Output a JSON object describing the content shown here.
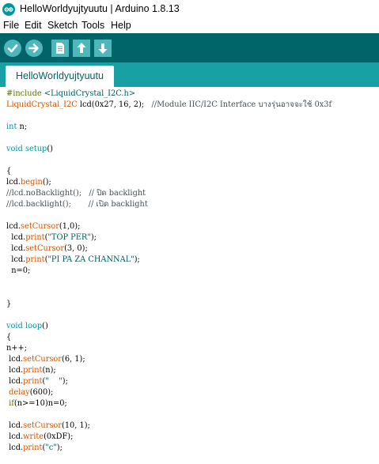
{
  "window": {
    "title": "HelloWorldyujtyuutu | Arduino 1.8.13",
    "app_icon": "arduino-logo-icon"
  },
  "menu": {
    "items": [
      "File",
      "Edit",
      "Sketch",
      "Tools",
      "Help"
    ]
  },
  "toolbar": {
    "buttons": [
      {
        "name": "verify",
        "icon": "checkmark-icon"
      },
      {
        "name": "upload",
        "icon": "arrow-right-icon"
      },
      {
        "name": "new",
        "icon": "new-file-icon"
      },
      {
        "name": "open",
        "icon": "arrow-up-icon"
      },
      {
        "name": "save",
        "icon": "arrow-down-icon"
      }
    ],
    "colors": {
      "bar": "#006468",
      "button": "#4db7bb",
      "tabbar": "#17a1a5"
    }
  },
  "tabs": [
    {
      "label": "HelloWorldyujtyuutu",
      "active": true
    }
  ],
  "code": {
    "include_directive": "#include",
    "include_file": "<LiquidCrystal_I2C.h>",
    "l2_class": "LiquidCrystal_I2C",
    "l2_rest": " lcd(0x27, 16, 2);   ",
    "l2_comment": "//Module IIC/I2C Interface บางรุ่นอาจจะใช้ 0x3f",
    "l4_type": "int",
    "l4_rest": " n;",
    "l6_type": "void",
    "l6_fn": "setup",
    "l6_rest": "()",
    "l8": "{",
    "l9_a": "lcd.",
    "l9_fn": "begin",
    "l9_b": "();",
    "l10_comment": "//lcd.noBacklight();   // ปิด backlight",
    "l11_comment": "//lcd.backlight();       // เปิด backlight",
    "l13_a": "lcd.",
    "l13_fn": "setCursor",
    "l13_b": "(1,0);",
    "l14_a": "  lcd.",
    "l14_fn": "print",
    "l14_b": "(",
    "l14_str": "\"TOP PER\"",
    "l14_c": ");",
    "l15_a": "  lcd.",
    "l15_fn": "setCursor",
    "l15_b": "(3, 0);",
    "l16_a": "  lcd.",
    "l16_fn": "print",
    "l16_b": "(",
    "l16_str": "\"PI PA ZA CHANNAL\"",
    "l16_c": ");",
    "l17": "  n=0;",
    "l20": "}",
    "l22_type": "void",
    "l22_fn": "loop",
    "l22_rest": "()",
    "l23": "{",
    "l24": "n++;",
    "l25_a": " lcd.",
    "l25_fn": "setCursor",
    "l25_b": "(6, 1);",
    "l26_a": " lcd.",
    "l26_fn": "print",
    "l26_b": "(n);",
    "l27_a": " lcd.",
    "l27_fn": "print",
    "l27_b": "(",
    "l27_str": "\"    \"",
    "l27_c": ");",
    "l28_fn": " delay",
    "l28_b": "(600);",
    "l29_kw": " if",
    "l29_b": "(n>=10)n=0;",
    "l31_a": " lcd.",
    "l31_fn": "setCursor",
    "l31_b": "(10, 1);",
    "l32_a": " lcd.",
    "l32_fn": "write",
    "l32_b": "(0xDF);",
    "l33_a": " lcd.",
    "l33_fn": "print",
    "l33_b": "(",
    "l33_str": "\"c\"",
    "l33_c": ");"
  }
}
